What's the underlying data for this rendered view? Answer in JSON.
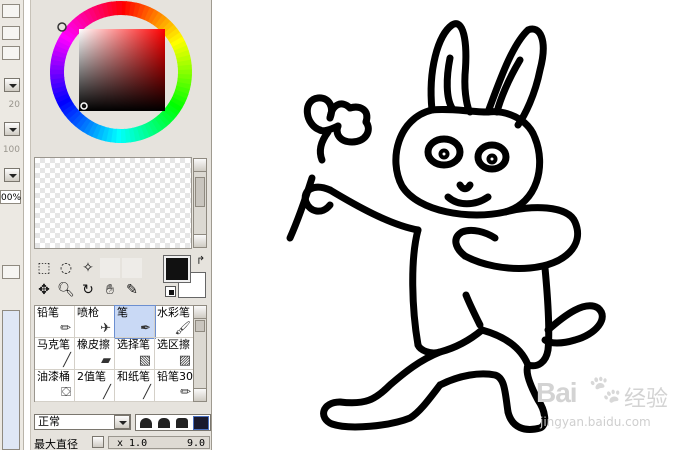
{
  "left_column": {
    "values": [
      "20",
      "100",
      "00%"
    ]
  },
  "brushes": [
    {
      "label": "铅笔",
      "icon": "pencil-icon"
    },
    {
      "label": "喷枪",
      "icon": "airbrush-icon"
    },
    {
      "label": "笔",
      "icon": "pen-icon",
      "selected": true
    },
    {
      "label": "水彩笔",
      "icon": "watercolor-icon"
    },
    {
      "label": "马克笔",
      "icon": "marker-icon"
    },
    {
      "label": "橡皮擦",
      "icon": "eraser-icon"
    },
    {
      "label": "选择笔",
      "icon": "select-pen-icon"
    },
    {
      "label": "选区擦",
      "icon": "select-eraser-icon"
    },
    {
      "label": "油漆桶",
      "icon": "bucket-icon"
    },
    {
      "label": "2值笔",
      "icon": "binary-pen-icon"
    },
    {
      "label": "和纸笔",
      "icon": "washi-pen-icon"
    },
    {
      "label": "铅笔30",
      "icon": "pencil30-icon"
    }
  ],
  "blend_mode": "正常",
  "max_size": {
    "label": "最大直径",
    "multiplier": "x 1.0",
    "value": "9.0"
  },
  "colors": {
    "foreground": "#111111",
    "background": "#ffffff",
    "panel": "#e6e3dd"
  },
  "watermark": {
    "logo": "Bai",
    "logo_suffix": "经验",
    "url": "jingyan.baidu.com"
  }
}
